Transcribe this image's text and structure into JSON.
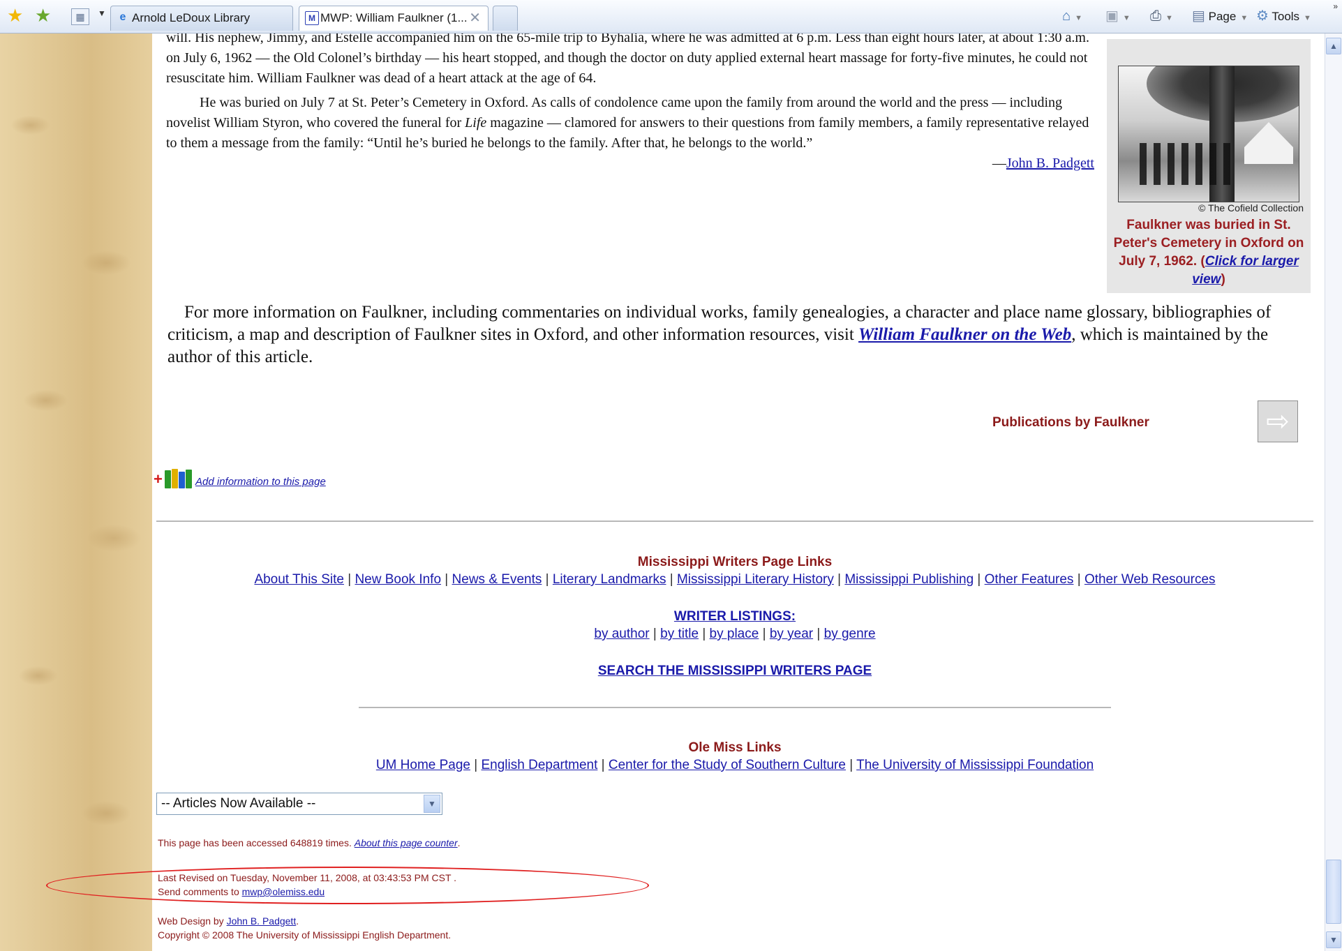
{
  "browser": {
    "tabs": [
      {
        "label": "Arnold LeDoux Library"
      },
      {
        "label": "MWP: William Faulkner (1..."
      }
    ],
    "tab_close_glyph": "✕",
    "toolbar": {
      "page_label": "Page",
      "tools_label": "Tools"
    },
    "icons": [
      "favorites-star-icon",
      "add-favorites-icon",
      "quick-tabs-icon",
      "home-icon",
      "feeds-icon",
      "print-icon",
      "page-icon",
      "tools-gear-icon"
    ]
  },
  "article": {
    "para1": "will. His nephew, Jimmy, and Estelle accompanied him on the 65-mile trip to Byhalia, where he was admitted at 6 p.m. Less than eight hours later, at about 1:30 a.m. on July 6, 1962 — the Old Colonel’s birthday — his heart stopped, and though the doctor on duty applied external heart massage for forty-five minutes, he could not resuscitate him. William Faulkner was dead of a heart attack at the age of 64.",
    "para2_a": "He was buried on July 7 at St. Peter’s Cemetery in Oxford. As calls of condolence came upon the family from around the world and the press — including novelist William Styron, who covered the funeral for ",
    "para2_italic": "Life",
    "para2_b": " magazine — clamored for answers to their questions from family members, a family representative relayed to them a message from the family: “Until he’s buried he belongs to the family. After that, he belongs to the world.”",
    "byline_prefix": "—",
    "byline_name": "John B. Padgett"
  },
  "photo": {
    "credit": "© The Cofield Collection",
    "caption": "Faulkner was buried in St. Peter's Cemetery in Oxford on July 7, 1962.",
    "link_text": "Click for larger view"
  },
  "more_info": {
    "text_before": "For more information on Faulkner, including commentaries on individual works, family genealogies, a character and place name glossary, bibliographies of criticism, a map and description of Faulkner sites in Oxford, and other information resources, visit ",
    "link": "William Faulkner on the Web",
    "text_after": ", which is maintained by the author of this article."
  },
  "publications_label": "Publications by Faulkner",
  "next_arrow_glyph": "⇨",
  "add_info_link": "Add information to this page",
  "mwp_links": {
    "title": "Mississippi Writers Page Links",
    "items": [
      "About This Site",
      "New Book Info",
      "News & Events",
      "Literary Landmarks",
      "Mississippi Literary History",
      "Mississippi Publishing",
      "Other Features",
      "Other Web Resources"
    ]
  },
  "writer_listings": {
    "title": "WRITER LISTINGS:",
    "items": [
      "by author",
      "by title",
      "by place",
      "by year",
      "by genre"
    ]
  },
  "search_link": "SEARCH THE MISSISSIPPI WRITERS PAGE",
  "ole_miss": {
    "title": "Ole Miss Links",
    "items": [
      "UM Home Page",
      "English Department",
      "Center for the Study of Southern Culture",
      "The University of Mississippi Foundation"
    ]
  },
  "articles_select": {
    "selected": "-- Articles Now Available --"
  },
  "footer": {
    "counter_text": "This page has been accessed 648819 times.",
    "counter_link": "About this page counter",
    "revised": "Last Revised on Tuesday, November 11, 2008, at 03:43:53 PM CST .",
    "send_comments_prefix": "Send comments to ",
    "email": "mwp@olemiss.edu",
    "design_prefix": "Web Design by ",
    "designer": "John B. Padgett",
    "copyright": "Copyright © 2008 The University of Mississippi English Department."
  },
  "colors": {
    "heading_red": "#8b1a1a",
    "link_blue": "#1a1aaa",
    "annotation_oval": "#e02020"
  }
}
